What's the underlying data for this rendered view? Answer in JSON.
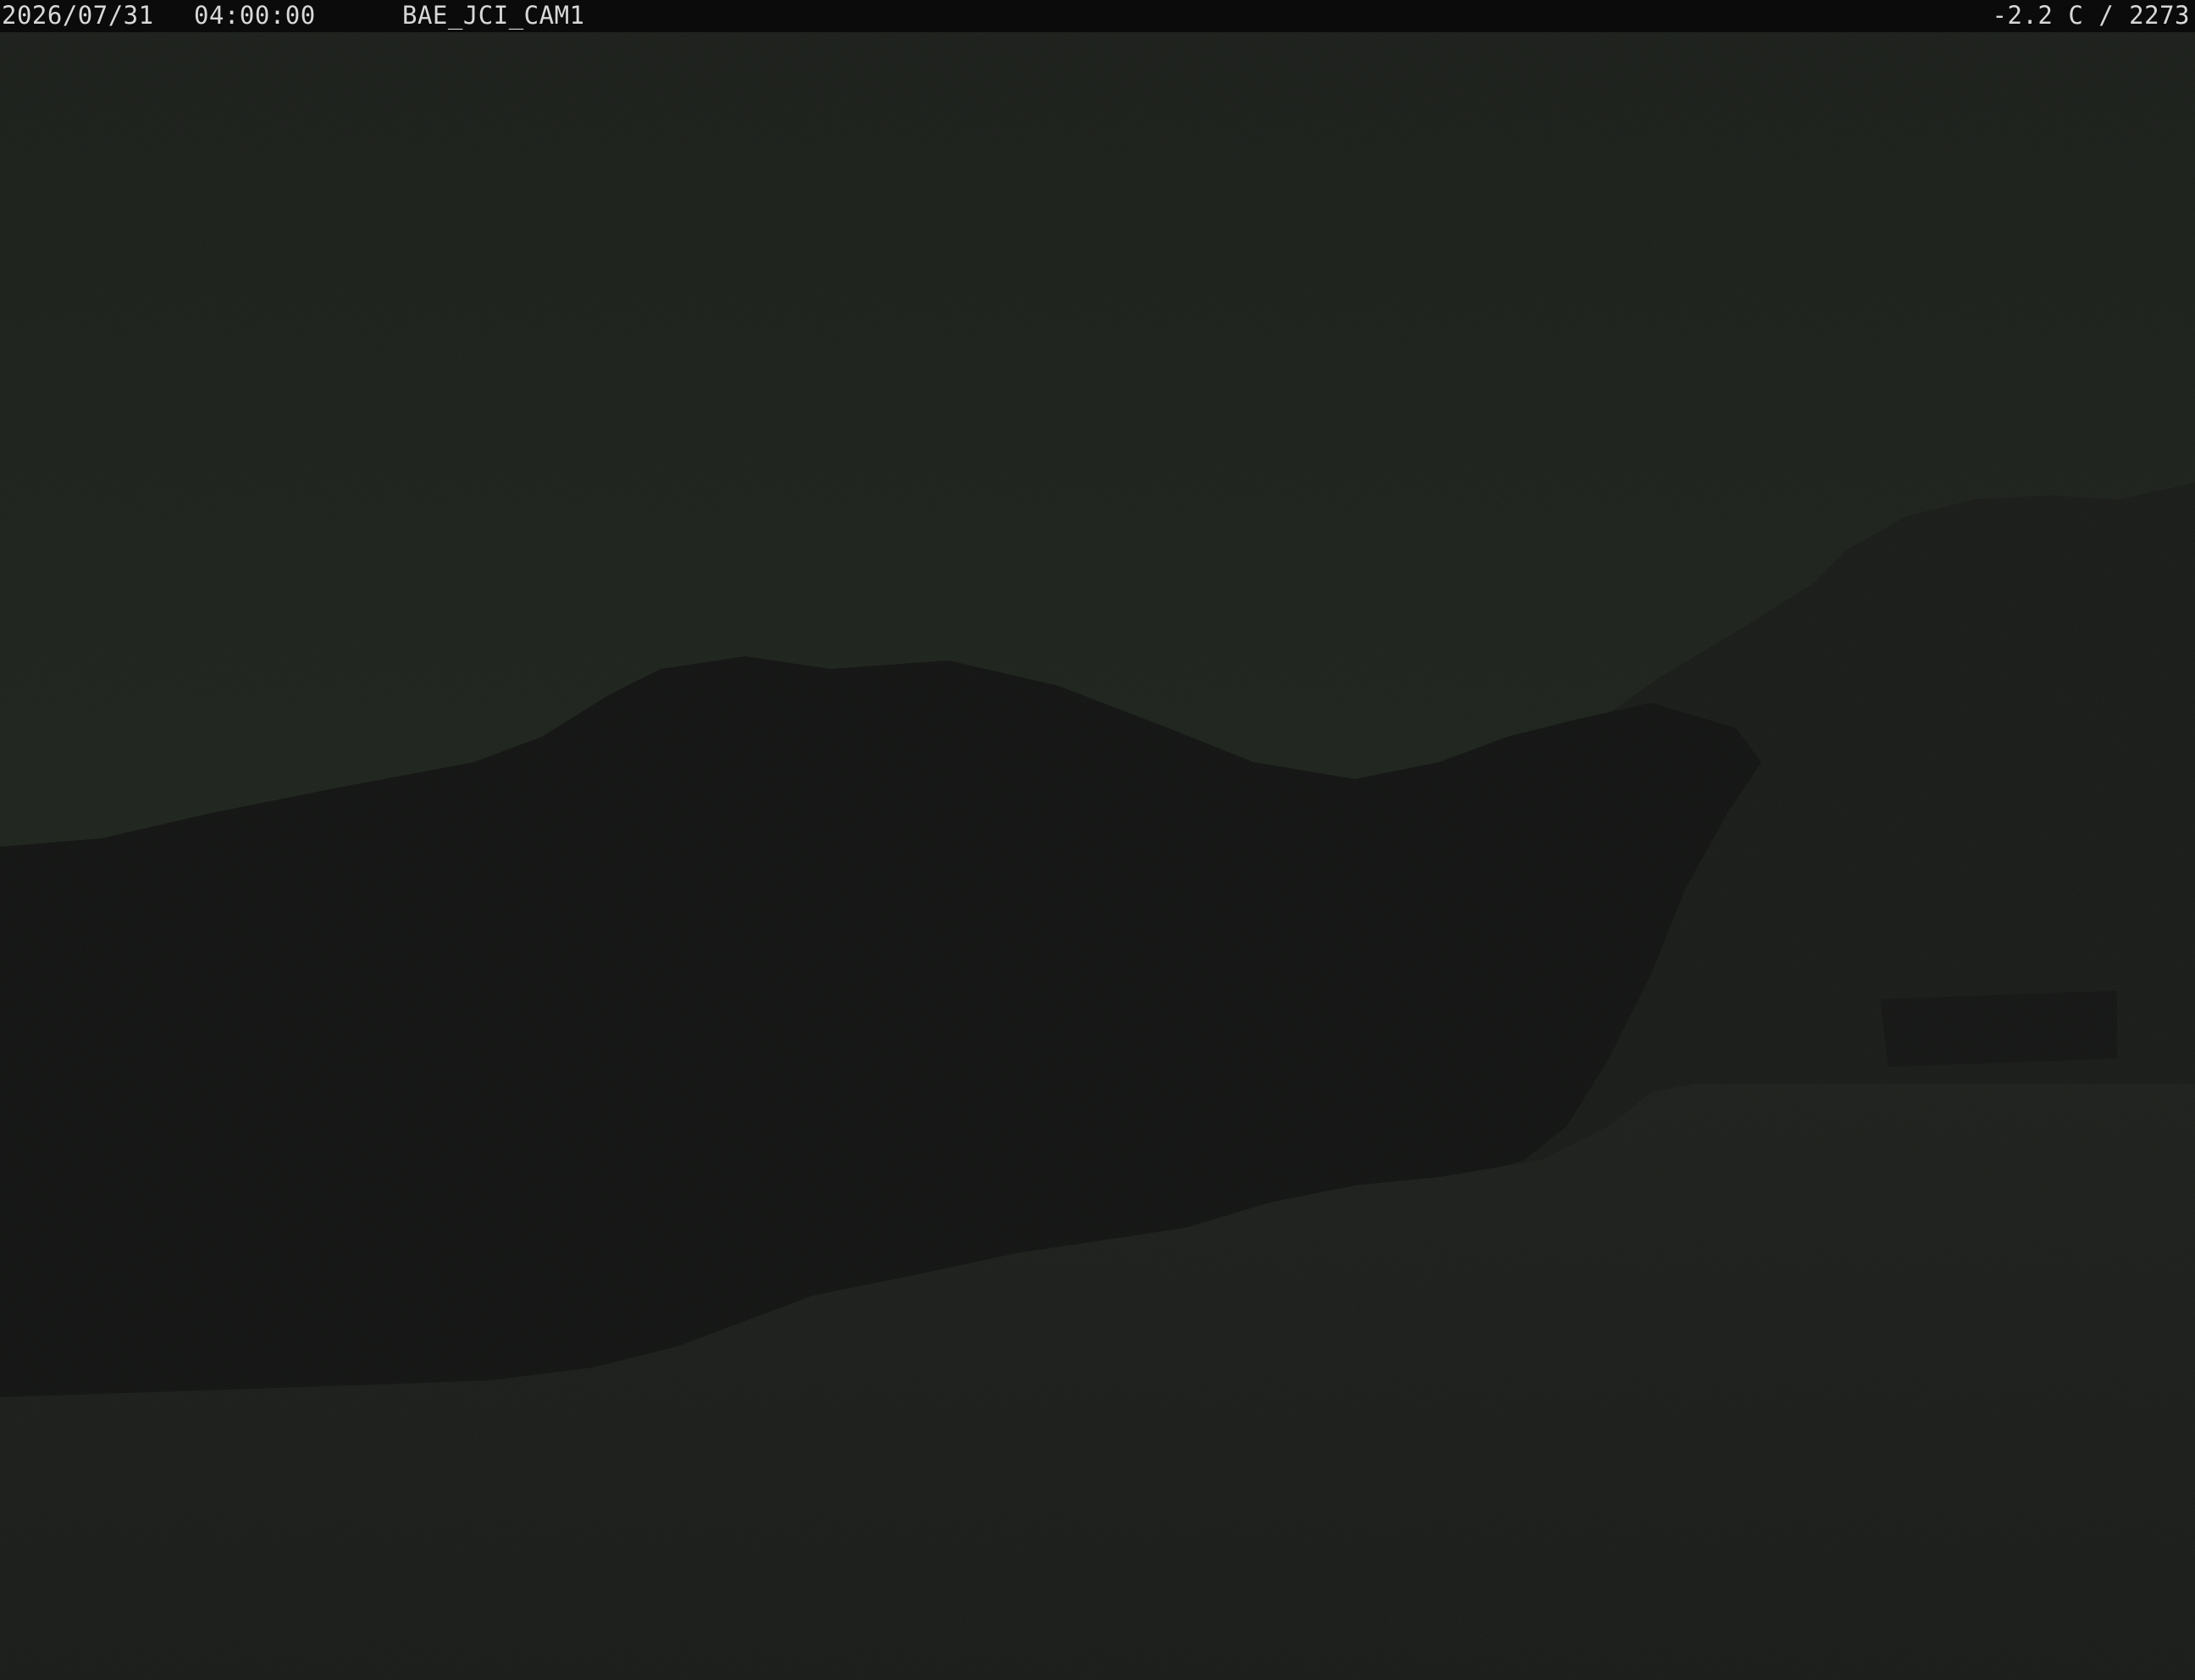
{
  "overlay": {
    "date": "2026/07/31",
    "time": "04:00:00",
    "camera_id": "BAE_JCI_CAM1",
    "readout": "-2.2 C / 2273"
  },
  "scene": {
    "subject": "night webcam view of dark mountain ridge with snowfield",
    "colors": {
      "sky": "#1d211c",
      "ridge": "#121212",
      "foreground_snow": "#1b1c1a",
      "overlay_bar": "#0b0b0b",
      "overlay_text": "#d8d8d8"
    }
  }
}
